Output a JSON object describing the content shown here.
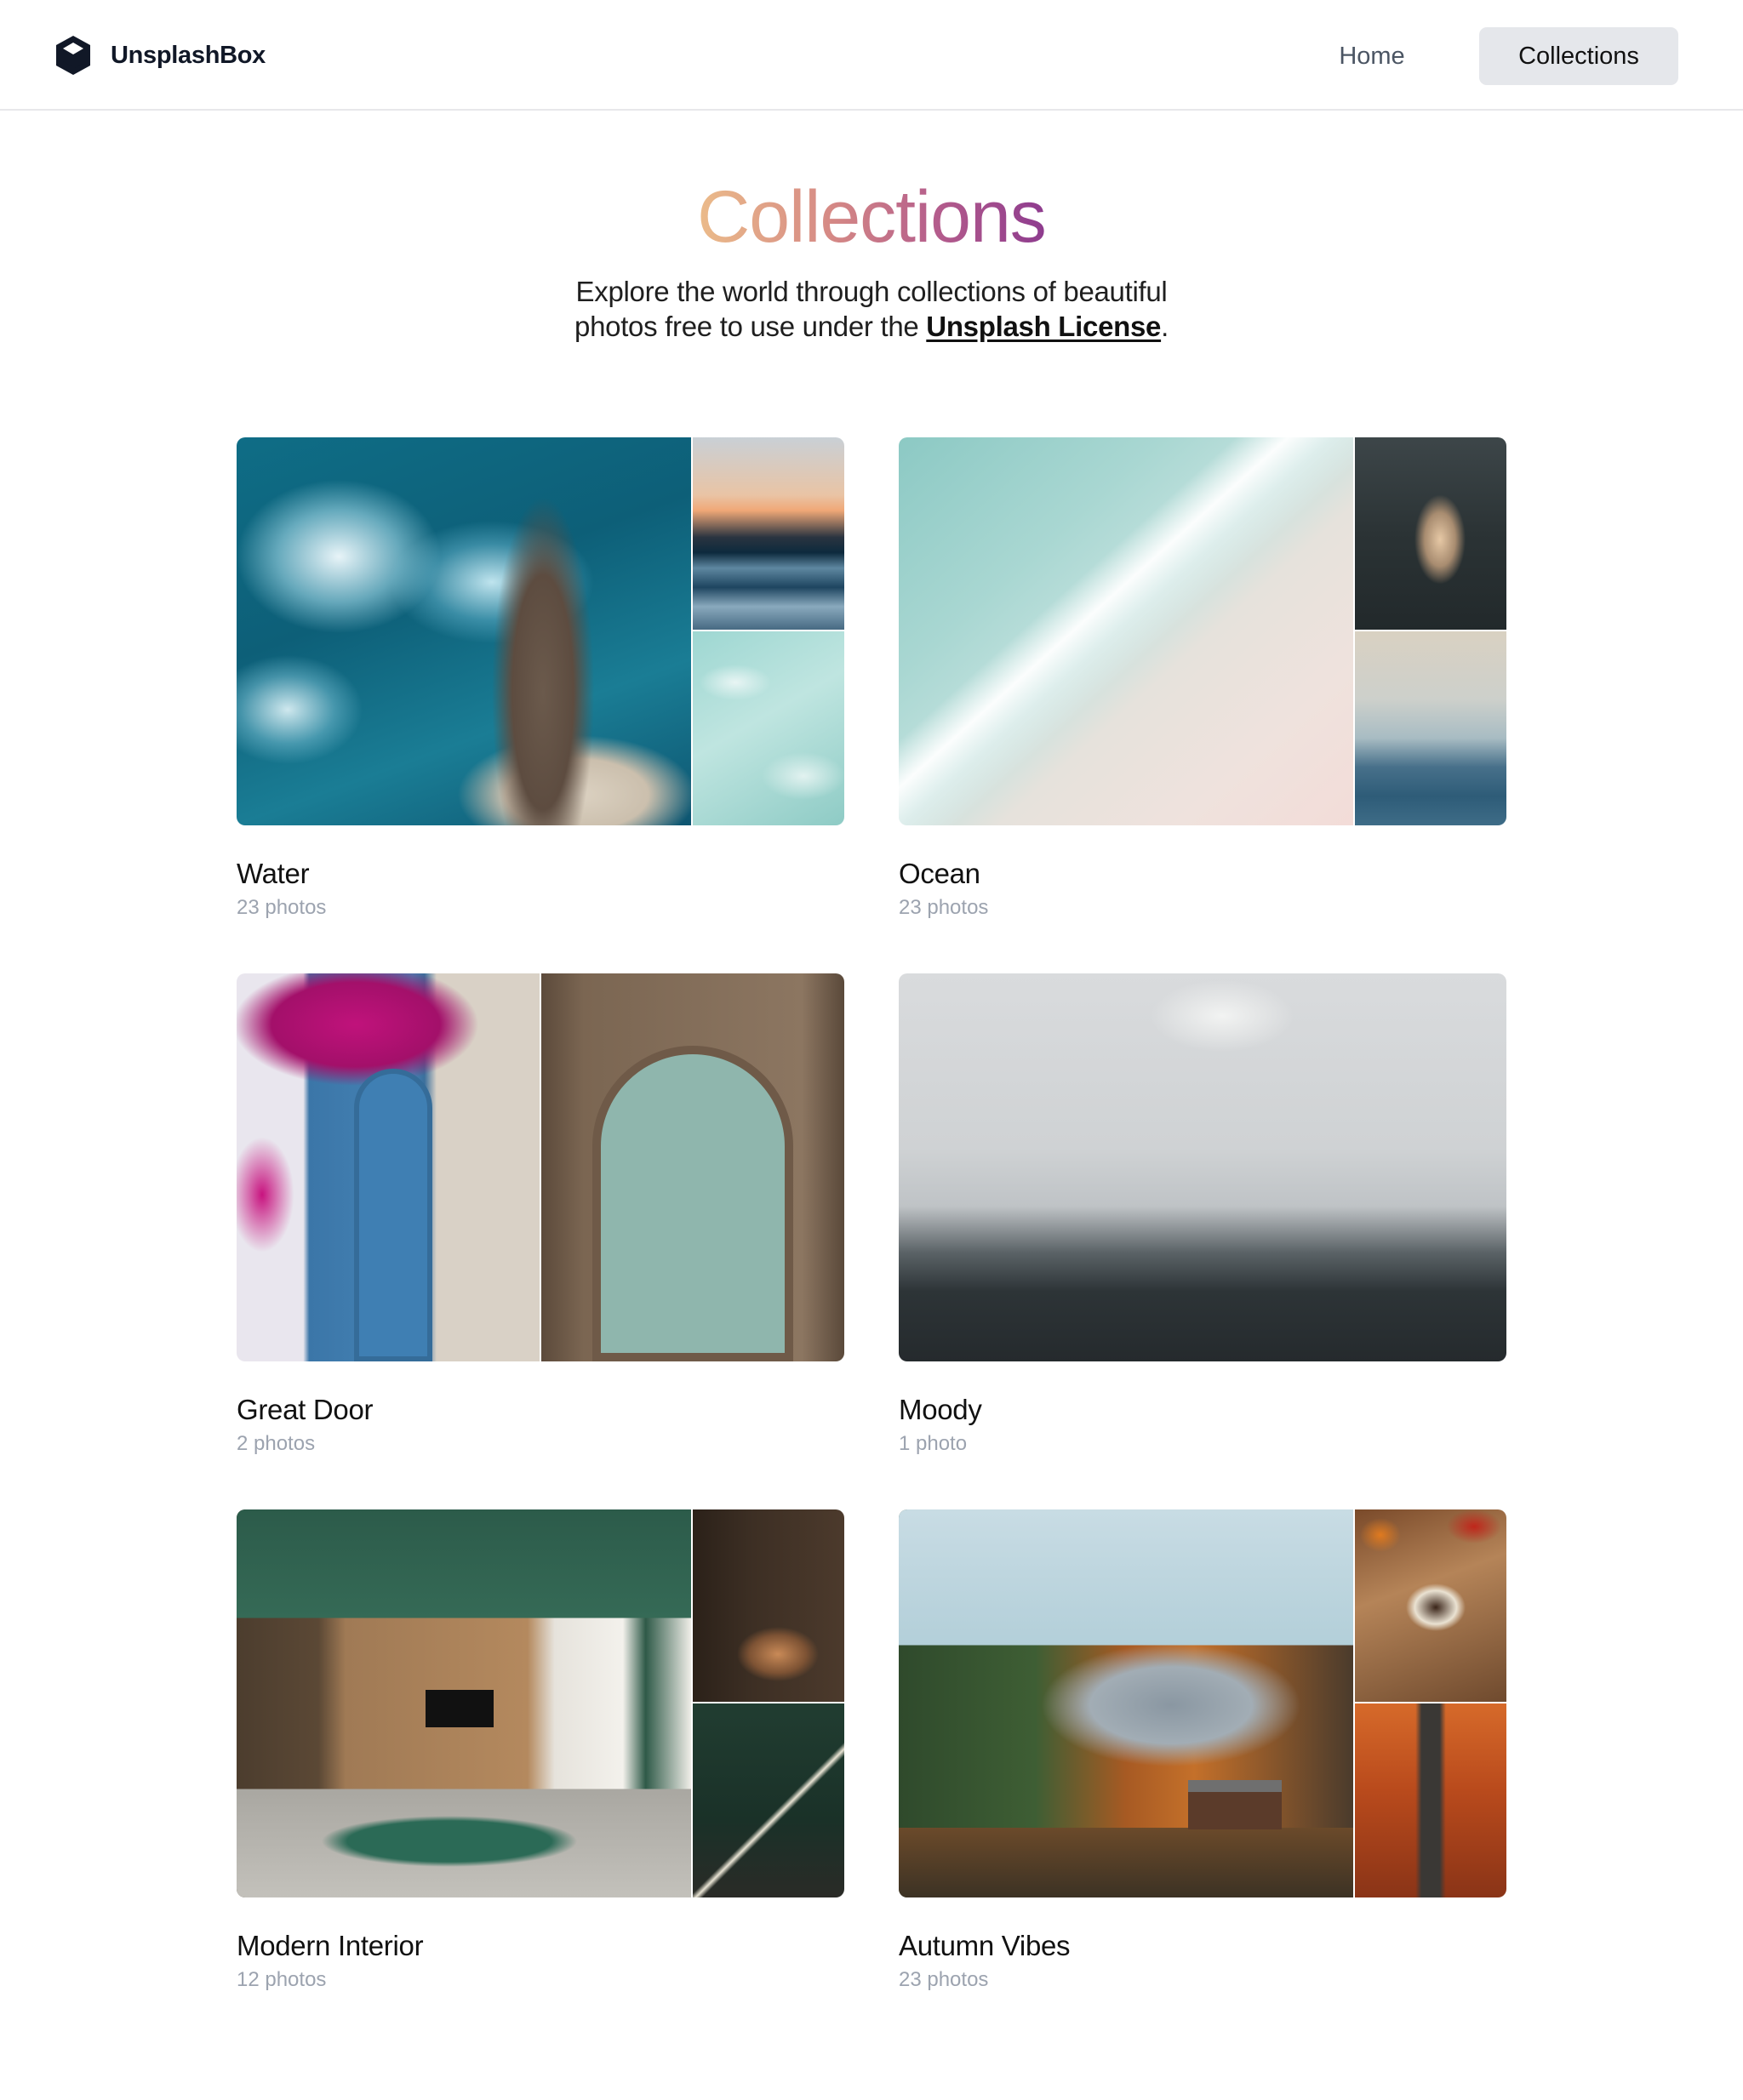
{
  "header": {
    "brand_name": "UnsplashBox",
    "nav": [
      {
        "label": "Home"
      },
      {
        "label": "Collections"
      }
    ]
  },
  "hero": {
    "title": "Collections",
    "subtitle_line1": "Explore the world through collections of beautiful",
    "subtitle_line2_prefix": "photos free to use under the ",
    "license_link": "Unsplash License",
    "subtitle_suffix": "."
  },
  "collections": [
    {
      "title": "Water",
      "count": "23 photos"
    },
    {
      "title": "Ocean",
      "count": "23 photos"
    },
    {
      "title": "Great Door",
      "count": "2 photos"
    },
    {
      "title": "Moody",
      "count": "1 photo"
    },
    {
      "title": "Modern Interior",
      "count": "12 photos"
    },
    {
      "title": "Autumn Vibes",
      "count": "23 photos"
    }
  ],
  "colors": {
    "title_gradient": [
      "#ecbd8a",
      "#8c3a8e"
    ],
    "active_nav_bg": "#e5e7eb",
    "muted_text": "#9ca3af"
  }
}
